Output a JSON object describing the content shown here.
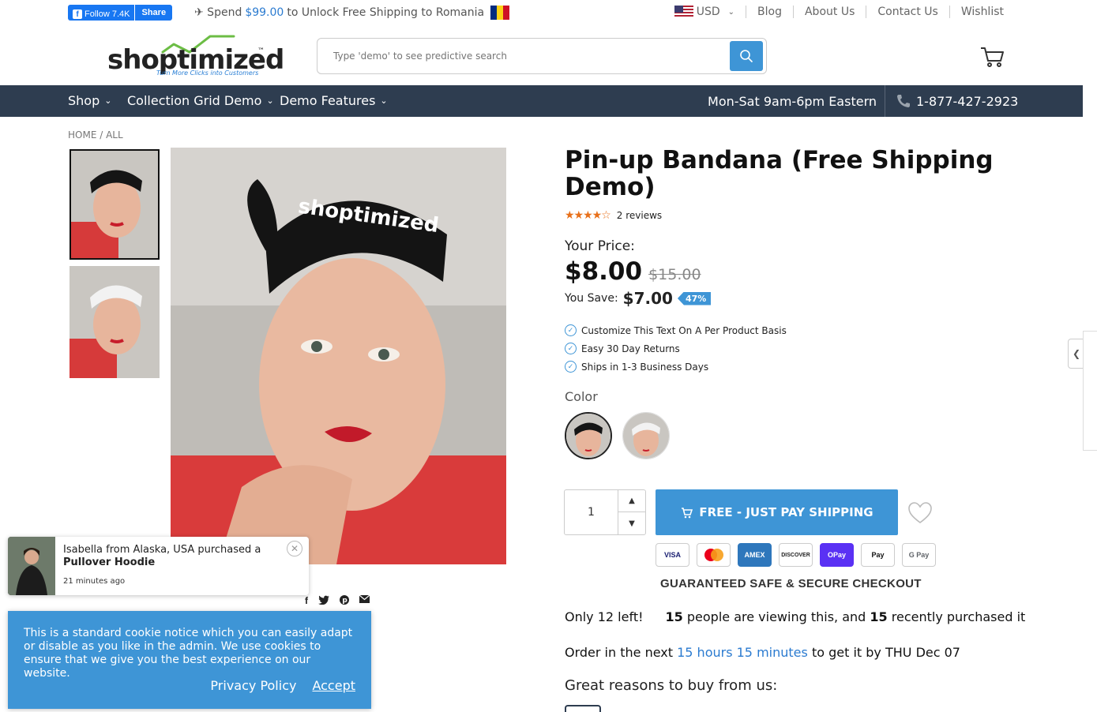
{
  "topbar": {
    "fb_follow": "Follow 7.4K",
    "fb_share": "Share",
    "promo_prefix": "✈ Spend",
    "promo_amount": "$99.00",
    "promo_suffix": "to Unlock Free Shipping to Romania",
    "currency": "USD",
    "links": [
      "Blog",
      "About Us",
      "Contact Us",
      "Wishlist"
    ]
  },
  "header": {
    "logo_text": "shoptimized",
    "logo_tagline": "Turn More Clicks into Customers",
    "search_placeholder": "Type 'demo' to see predictive search"
  },
  "nav": {
    "items": [
      "Shop",
      "Collection Grid Demo",
      "Demo Features"
    ],
    "hours": "Mon-Sat 9am-6pm Eastern",
    "phone": "1-877-427-2923"
  },
  "breadcrumb": "HOME / ALL",
  "product": {
    "title": "Pin-up Bandana (Free Shipping Demo)",
    "stars": "★★★★☆",
    "reviews": "2 reviews",
    "price_label": "Your Price:",
    "price": "$8.00",
    "compare_price": "$15.00",
    "save_label": "You Save:",
    "save_amount": "$7.00",
    "save_percent": "47%",
    "features": [
      "Customize This Text On A Per Product Basis",
      "Easy 30 Day Returns",
      "Ships in 1-3 Business Days"
    ],
    "color_label": "Color",
    "quantity": "1",
    "buy_button": "FREE - JUST PAY SHIPPING",
    "payment_methods": [
      "VISA",
      "MC",
      "AMEX",
      "DISCOVER",
      "OPay",
      "Pay",
      "G Pay"
    ],
    "secure_text": "GUARANTEED SAFE & SECURE CHECKOUT",
    "stock_text": "Only 12 left!",
    "viewing_count": "15",
    "viewing_text": "people are viewing this, and",
    "purchased_count": "15",
    "purchased_text": "recently purchased it",
    "order_prefix": "Order in the next",
    "order_time": "15 hours 15 minutes",
    "order_suffix": "to get it by THU Dec 07",
    "reasons_title": "Great reasons to buy from us:"
  },
  "popup": {
    "text": "Isabella from Alaska, USA purchased a",
    "product": "Pullover Hoodie",
    "time": "21 minutes ago"
  },
  "cookie": {
    "text": "This is a standard cookie notice which you can easily adapt or disable as you like in the admin. We use cookies to ensure that we give you the best experience on our website.",
    "privacy": "Privacy Policy",
    "accept": "Accept"
  }
}
